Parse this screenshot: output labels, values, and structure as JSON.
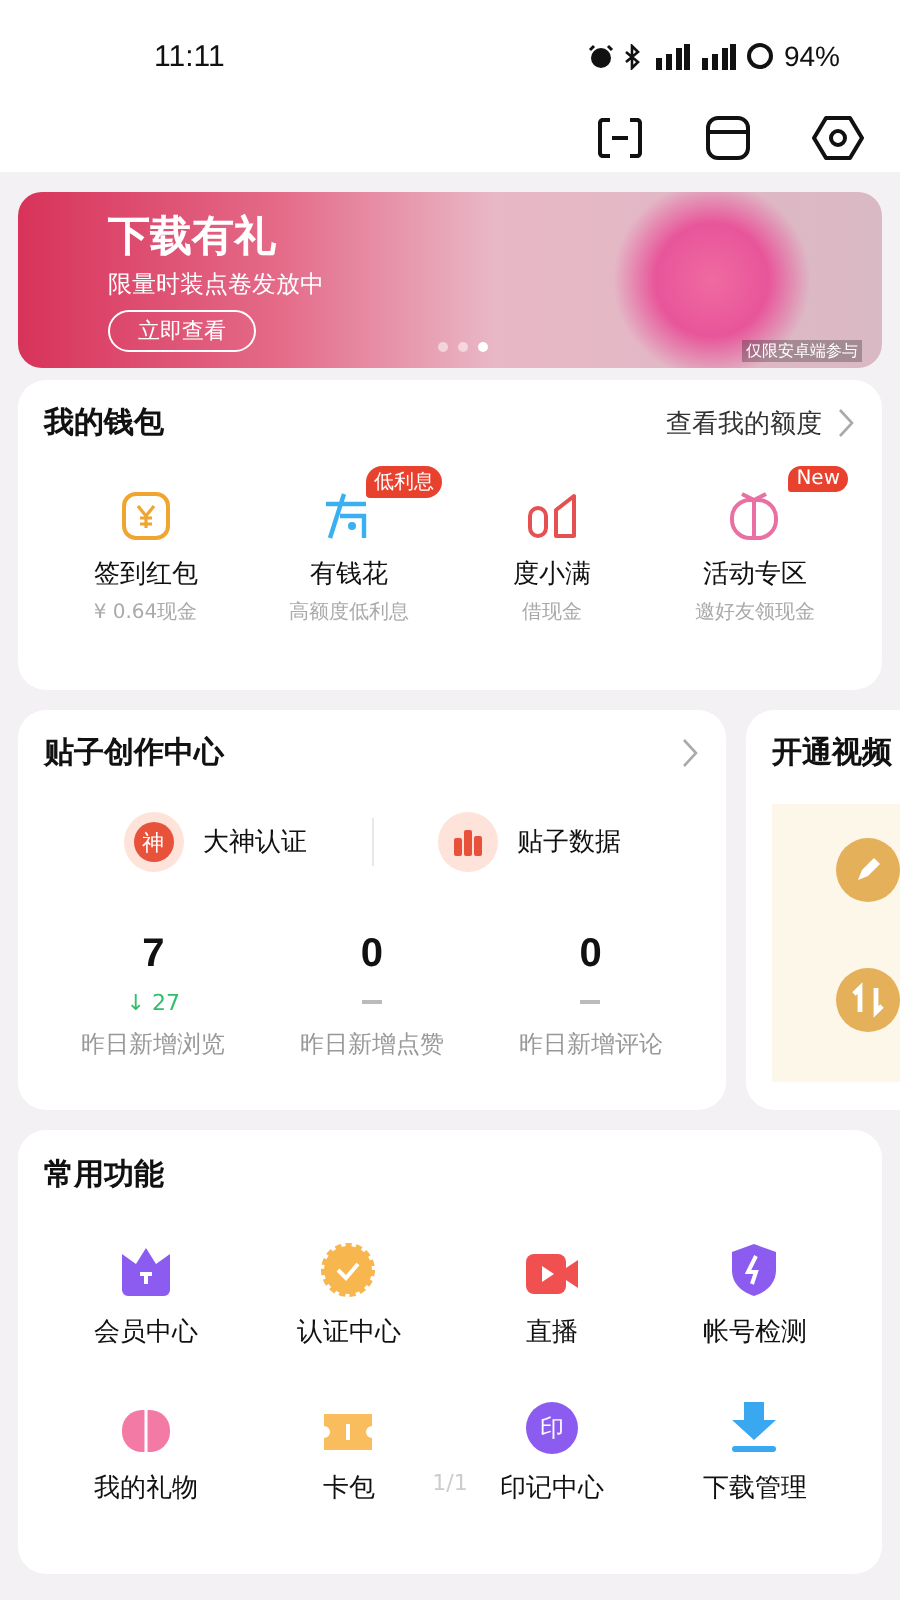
{
  "status_bar": {
    "time": "11:11",
    "battery": "94%"
  },
  "banner": {
    "title": "下载有礼",
    "subtitle": "限量时装点卷发放中",
    "button": "立即查看",
    "note": "仅限安卓端参与",
    "dots": [
      {
        "selected": false
      },
      {
        "selected": false
      },
      {
        "selected": true
      }
    ]
  },
  "wallet": {
    "title": "我的钱包",
    "link": "查看我的额度",
    "items": [
      {
        "kind": "yen",
        "label": "签到红包",
        "sub": "¥ 0.64现金"
      },
      {
        "kind": "flower",
        "label": "有钱花",
        "sub": "高额度低利息",
        "badge": "低利息"
      },
      {
        "kind": "bars",
        "label": "度小满",
        "sub": "借现金"
      },
      {
        "kind": "gift",
        "label": "活动专区",
        "sub": "邀好友领现金",
        "badge": "New"
      }
    ]
  },
  "creation": {
    "title": "贴子创作中心",
    "shortcuts": [
      {
        "kind": "god",
        "glyph": "神",
        "label": "大神认证"
      },
      {
        "kind": "chart",
        "label": "贴子数据"
      }
    ],
    "stats": [
      {
        "value": "7",
        "change": "↓ 27",
        "label": "昨日新增浏览"
      },
      {
        "value": "0",
        "label": "昨日新增点赞"
      },
      {
        "value": "0",
        "label": "昨日新增评论"
      }
    ]
  },
  "video_card": {
    "title": "开通视频"
  },
  "functions": {
    "title": "常用功能",
    "page": "1/1",
    "items": [
      {
        "kind": "crown",
        "label": "会员中心"
      },
      {
        "kind": "badge",
        "label": "认证中心"
      },
      {
        "kind": "live",
        "label": "直播"
      },
      {
        "kind": "shield",
        "label": "帐号检测"
      },
      {
        "kind": "present",
        "label": "我的礼物"
      },
      {
        "kind": "ticket",
        "label": "卡包"
      },
      {
        "kind": "seal",
        "label": "印记中心",
        "glyph": "印"
      },
      {
        "kind": "download",
        "label": "下载管理"
      }
    ]
  }
}
